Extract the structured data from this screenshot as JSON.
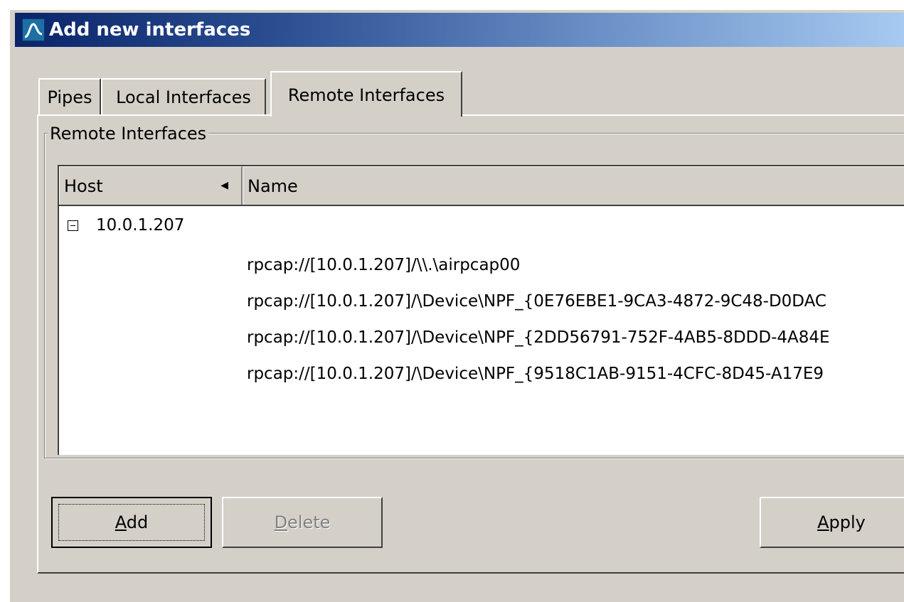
{
  "window": {
    "title": "Add new interfaces"
  },
  "tabs": [
    {
      "label": "Pipes"
    },
    {
      "label": "Local Interfaces"
    },
    {
      "label": "Remote Interfaces",
      "selected": true
    }
  ],
  "remote": {
    "group_label": "Remote Interfaces",
    "columns": {
      "host": "Host",
      "name": "Name"
    },
    "host": "10.0.1.207",
    "interfaces": [
      "rpcap://[10.0.1.207]/\\\\.\\airpcap00",
      "rpcap://[10.0.1.207]/\\Device\\NPF_{0E76EBE1-9CA3-4872-9C48-D0DAC",
      "rpcap://[10.0.1.207]/\\Device\\NPF_{2DD56791-752F-4AB5-8DDD-4A84E",
      "rpcap://[10.0.1.207]/\\Device\\NPF_{9518C1AB-9151-4CFC-8D45-A17E9"
    ]
  },
  "buttons": {
    "add": {
      "mnemonic": "A",
      "rest": "dd"
    },
    "delete": {
      "mnemonic": "D",
      "rest": "elete"
    },
    "apply": {
      "mnemonic": "A",
      "rest": "pply"
    }
  },
  "colors": {
    "titlebar_start": "#0a246a",
    "titlebar_end": "#a6caf0",
    "face": "#d4d0c8"
  }
}
